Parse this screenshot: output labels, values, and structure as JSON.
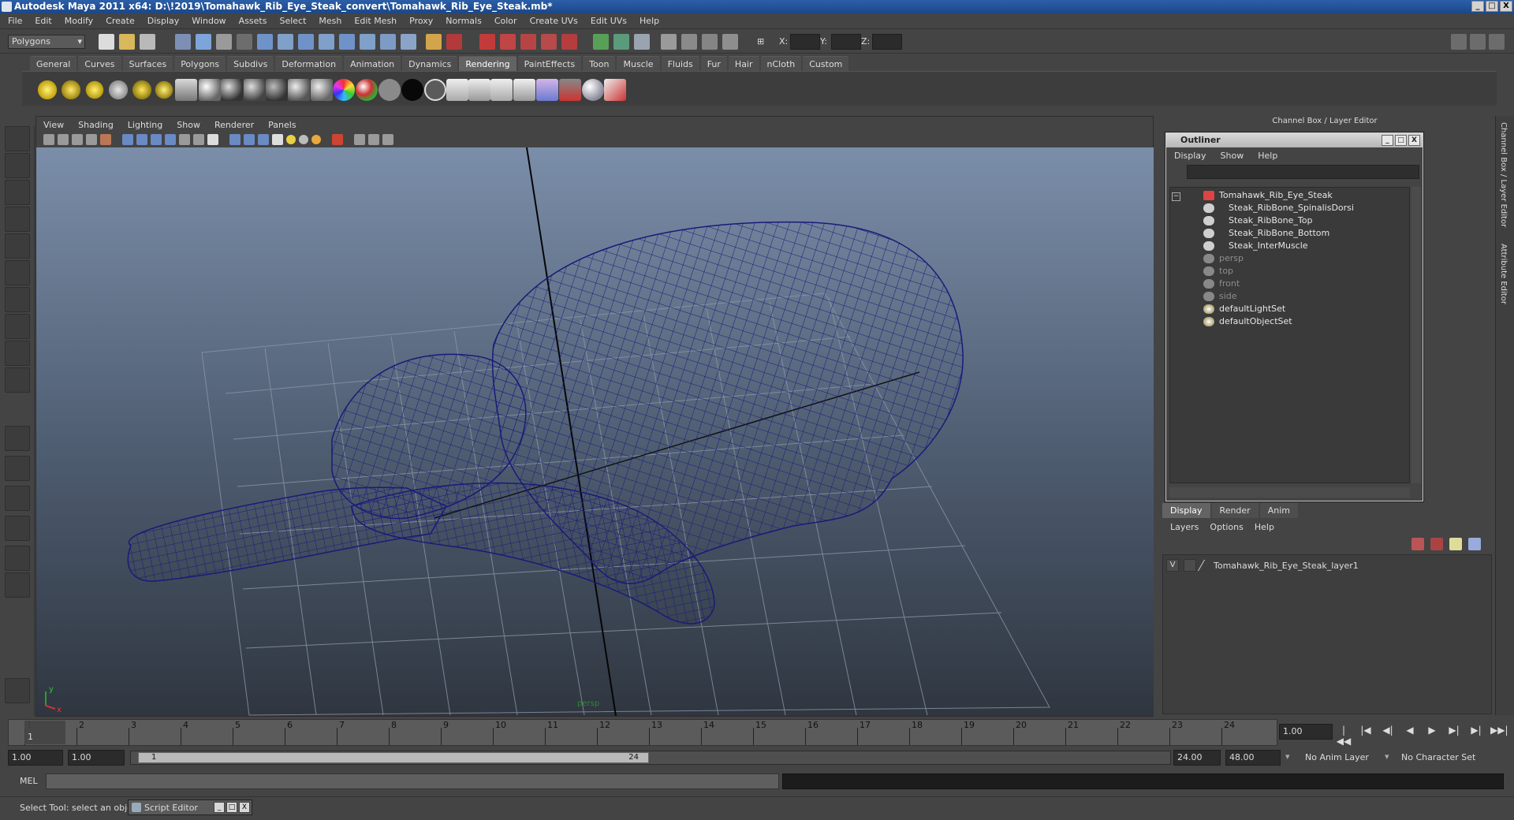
{
  "window": {
    "title": "Autodesk Maya 2011 x64: D:\\!2019\\Tomahawk_Rib_Eye_Steak_convert\\Tomahawk_Rib_Eye_Steak.mb*",
    "minimize": "_",
    "maximize": "□",
    "close": "X"
  },
  "menubar": [
    "File",
    "Edit",
    "Modify",
    "Create",
    "Display",
    "Window",
    "Assets",
    "Select",
    "Mesh",
    "Edit Mesh",
    "Proxy",
    "Normals",
    "Color",
    "Create UVs",
    "Edit UVs",
    "Help"
  ],
  "statusline": {
    "menu_set": "Polygons",
    "x_label": "X:",
    "y_label": "Y:",
    "z_label": "Z:"
  },
  "shelf": {
    "tabs": [
      "General",
      "Curves",
      "Surfaces",
      "Polygons",
      "Subdivs",
      "Deformation",
      "Animation",
      "Dynamics",
      "Rendering",
      "PaintEffects",
      "Toon",
      "Muscle",
      "Fluids",
      "Fur",
      "Hair",
      "nCloth",
      "Custom"
    ],
    "active_tab": "Rendering"
  },
  "viewport": {
    "menu": [
      "View",
      "Shading",
      "Lighting",
      "Show",
      "Renderer",
      "Panels"
    ],
    "camera_label": "persp",
    "axis_x": "x",
    "axis_y": "y"
  },
  "channel_box": {
    "header": "Channel Box / Layer Editor",
    "side_tabs": [
      "Channel Box / Layer Editor",
      "Attribute Editor"
    ]
  },
  "outliner": {
    "title": "Outliner",
    "menu": [
      "Display",
      "Show",
      "Help"
    ],
    "collapse": "−",
    "items": [
      {
        "label": "Tomahawk_Rib_Eye_Steak",
        "indent": 0,
        "dim": false
      },
      {
        "label": "Steak_RibBone_SpinalisDorsi",
        "indent": 1,
        "dim": false
      },
      {
        "label": "Steak_RibBone_Top",
        "indent": 1,
        "dim": false
      },
      {
        "label": "Steak_RibBone_Bottom",
        "indent": 1,
        "dim": false
      },
      {
        "label": "Steak_InterMuscle",
        "indent": 1,
        "dim": false
      },
      {
        "label": "persp",
        "indent": 0,
        "dim": true
      },
      {
        "label": "top",
        "indent": 0,
        "dim": true
      },
      {
        "label": "front",
        "indent": 0,
        "dim": true
      },
      {
        "label": "side",
        "indent": 0,
        "dim": true
      },
      {
        "label": "defaultLightSet",
        "indent": 0,
        "dim": false
      },
      {
        "label": "defaultObjectSet",
        "indent": 0,
        "dim": false
      }
    ]
  },
  "layer_editor": {
    "tabs": [
      "Display",
      "Render",
      "Anim"
    ],
    "active_tab": "Display",
    "menu": [
      "Layers",
      "Options",
      "Help"
    ],
    "layers": [
      {
        "visible": "V",
        "name": "Tomahawk_Rib_Eye_Steak_layer1"
      }
    ]
  },
  "timeline": {
    "frames": [
      "1",
      "2",
      "3",
      "4",
      "5",
      "6",
      "7",
      "8",
      "9",
      "10",
      "11",
      "12",
      "13",
      "14",
      "15",
      "16",
      "17",
      "18",
      "19",
      "20",
      "21",
      "22",
      "23",
      "24"
    ],
    "current_frame_marker": "1",
    "current_time": "1.00",
    "playback": [
      "|◀◀",
      "|◀",
      "◀|",
      "◀",
      "▶",
      "▶|",
      "▶|",
      "▶▶|"
    ]
  },
  "range": {
    "start_time": "1.00",
    "playback_start": "1.00",
    "slider_start": "1",
    "slider_end": "24",
    "playback_end": "24.00",
    "end_time": "48.00",
    "anim_layer": "No Anim Layer",
    "character_set": "No Character Set"
  },
  "command_line": {
    "label": "MEL"
  },
  "help_line": {
    "text": "Select Tool: select an object",
    "script_editor": "Script Editor"
  },
  "colors": {
    "wireframe": "#1a1a7a",
    "ui_bg": "#444444",
    "title_blue": "#2b5fa8"
  }
}
